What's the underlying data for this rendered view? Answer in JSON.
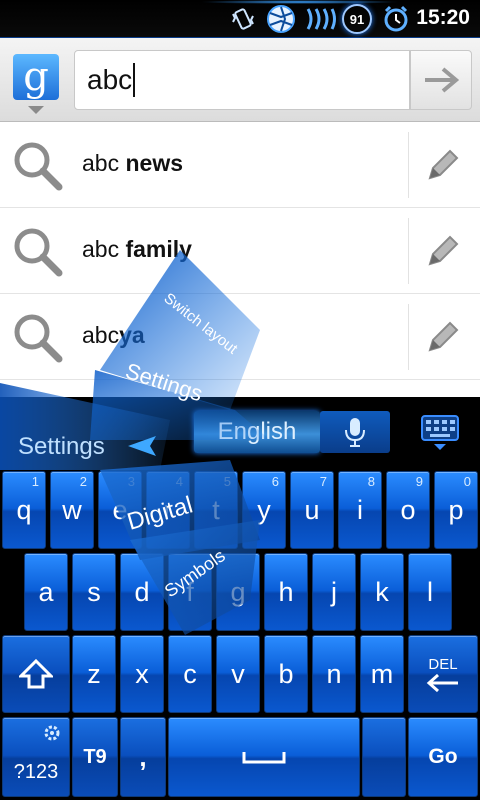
{
  "status_bar": {
    "time": "15:20",
    "battery": "91"
  },
  "search": {
    "query": "abc",
    "provider_letter": "g"
  },
  "suggestions": [
    {
      "prefix": "abc ",
      "bold": "news"
    },
    {
      "prefix": "abc ",
      "bold": "family"
    },
    {
      "prefix": "abc",
      "bold": "ya"
    }
  ],
  "keyboard": {
    "language": "English",
    "row1": [
      {
        "label": "q",
        "hint": "1"
      },
      {
        "label": "w",
        "hint": "2"
      },
      {
        "label": "e",
        "hint": "3"
      },
      {
        "label": "r",
        "hint": "4"
      },
      {
        "label": "t",
        "hint": "5"
      },
      {
        "label": "y",
        "hint": "6"
      },
      {
        "label": "u",
        "hint": "7"
      },
      {
        "label": "i",
        "hint": "8"
      },
      {
        "label": "o",
        "hint": "9"
      },
      {
        "label": "p",
        "hint": "0"
      }
    ],
    "row2": [
      "a",
      "s",
      "d",
      "f",
      "g",
      "h",
      "j",
      "k",
      "l"
    ],
    "row3": [
      "z",
      "x",
      "c",
      "v",
      "b",
      "n",
      "m"
    ],
    "del_label": "DEL",
    "sym_label": "?123",
    "t9_label": "T9",
    "comma_label": ",",
    "go_label": "Go"
  },
  "radial_menu": {
    "left_label": "Settings",
    "items": [
      "Switch layout",
      "Settings",
      "Digital",
      "Symbols"
    ]
  },
  "colors": {
    "accent": "#0a5ed8",
    "key_text": "#ffffff"
  }
}
